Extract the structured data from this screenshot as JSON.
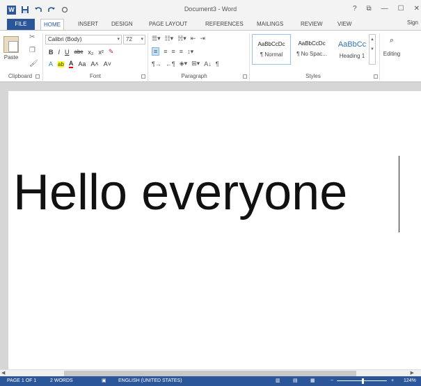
{
  "window": {
    "title": "Document3 - Word",
    "controls": [
      "?",
      "⧉",
      "—",
      "☐",
      "✕"
    ]
  },
  "qat": {
    "logo": "W",
    "save_icon": "💾",
    "undo_icon": "↶",
    "redo_icon": "↷",
    "extra_icon": "⚙"
  },
  "tabs": {
    "file": "FILE",
    "items": [
      "HOME",
      "INSERT",
      "DESIGN",
      "PAGE LAYOUT",
      "REFERENCES",
      "MAILINGS",
      "REVIEW",
      "VIEW"
    ],
    "active": "HOME",
    "signin": "Sign"
  },
  "ribbon": {
    "clipboard": {
      "paste_label": "Paste",
      "group_label": "Clipboard"
    },
    "font": {
      "font_name": "Calibri (Body)",
      "font_size": "72",
      "bold": "B",
      "italic": "I",
      "underline": "U",
      "strike": "abc",
      "subscript": "x₂",
      "superscript": "x²",
      "grow": "A˄",
      "shrink": "A˅",
      "case": "Aa",
      "text_effect": "A",
      "highlight": "ab",
      "font_color": "A",
      "group_label": "Font"
    },
    "paragraph": {
      "group_label": "Paragraph",
      "sort": "A↓",
      "pilcrow": "¶"
    },
    "styles": {
      "group_label": "Styles",
      "items": [
        {
          "sample": "AaBbCcDc",
          "name": "¶ Normal"
        },
        {
          "sample": "AaBbCcDc",
          "name": "¶ No Spac..."
        },
        {
          "sample": "AaBbCc",
          "name": "Heading 1"
        }
      ]
    },
    "editing": {
      "label": "Editing"
    }
  },
  "document": {
    "text": "Hello everyone"
  },
  "status": {
    "page": "PAGE 1 OF 1",
    "words": "2 WORDS",
    "language": "ENGLISH (UNITED STATES)",
    "zoom": "124%",
    "zoom_minus": "−",
    "zoom_plus": "+"
  },
  "colors": {
    "accent": "#2b579a",
    "ribbon_bg": "#ffffff",
    "doc_bg": "#d6d6d6",
    "heading_blue": "#2e74b5"
  }
}
